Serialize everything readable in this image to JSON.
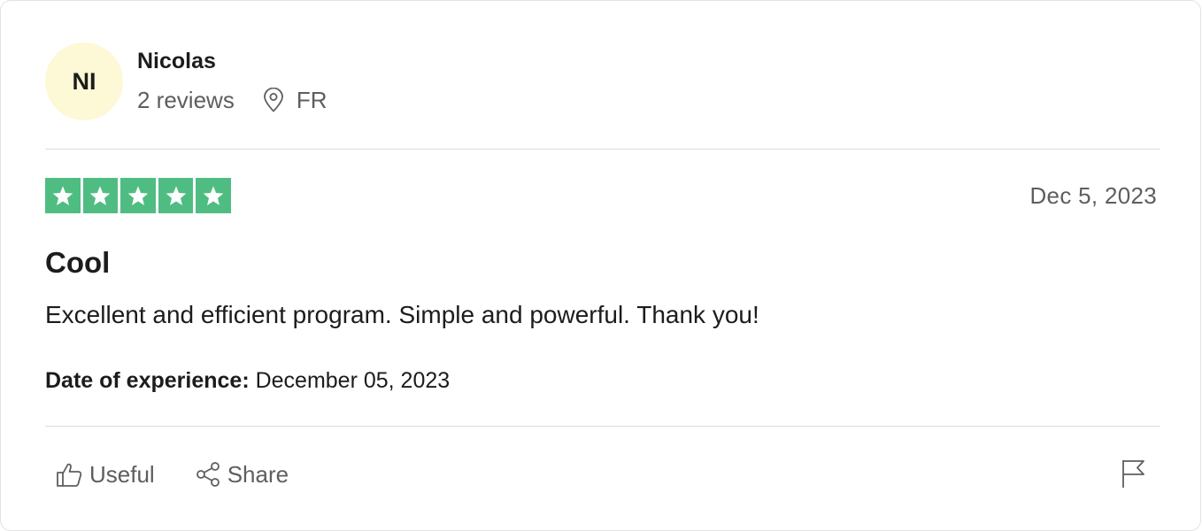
{
  "consumer": {
    "initials": "NI",
    "name": "Nicolas",
    "reviews_count": "2 reviews",
    "country": "FR"
  },
  "review": {
    "rating": 5,
    "rating_max": 5,
    "date": "Dec 5, 2023",
    "title": "Cool",
    "text": "Excellent and efficient program. Simple and powerful. Thank you!",
    "experience_label": "Date of experience:",
    "experience_date": "December 05, 2023"
  },
  "actions": {
    "useful_label": "Useful",
    "share_label": "Share"
  },
  "icons": {
    "location": "map-pin-icon",
    "useful": "thumbs-up-icon",
    "share": "share-icon",
    "report": "flag-icon",
    "star": "star-icon"
  },
  "colors": {
    "star_green": "#4fbd82",
    "avatar_bg": "#fdf8d5",
    "text_primary": "#1c1c1c",
    "text_secondary": "#5e5e5e"
  }
}
